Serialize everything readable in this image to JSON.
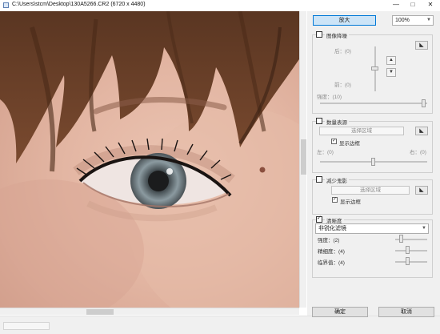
{
  "window": {
    "title": "C:\\Users\\stcm\\Desktop\\130A5266.CR2 (6720 x 4480)",
    "minimize": "—",
    "maximize": "□",
    "close": "✕"
  },
  "toolbar": {
    "zoom_button": "放大",
    "zoom_level": "100%"
  },
  "image_noise": {
    "label": "图像降噪",
    "checked": false,
    "after_label": "后：(0)",
    "before_label": "前：(0)",
    "strength_label": "强度：(10)"
  },
  "chromatic": {
    "label": "数量表源",
    "checked": false,
    "select_region": "选择区域",
    "show_border": "显示边框",
    "show_border_checked": true,
    "left_label": "左：(0)",
    "right_label": "右：(0)"
  },
  "ghosting": {
    "label": "减少鬼影",
    "checked": false,
    "select_region": "选择区域",
    "show_border": "显示边框",
    "show_border_checked": true
  },
  "sharpness": {
    "label": "清晰度",
    "checked": true,
    "filter": "非锐化滤镜",
    "strength_label": "强度：(2)",
    "fineness_label": "精细度：(4)",
    "threshold_label": "临界值：(4)"
  },
  "footer": {
    "ok": "确定",
    "cancel": "取消"
  },
  "icons": {
    "pick": "◣"
  }
}
